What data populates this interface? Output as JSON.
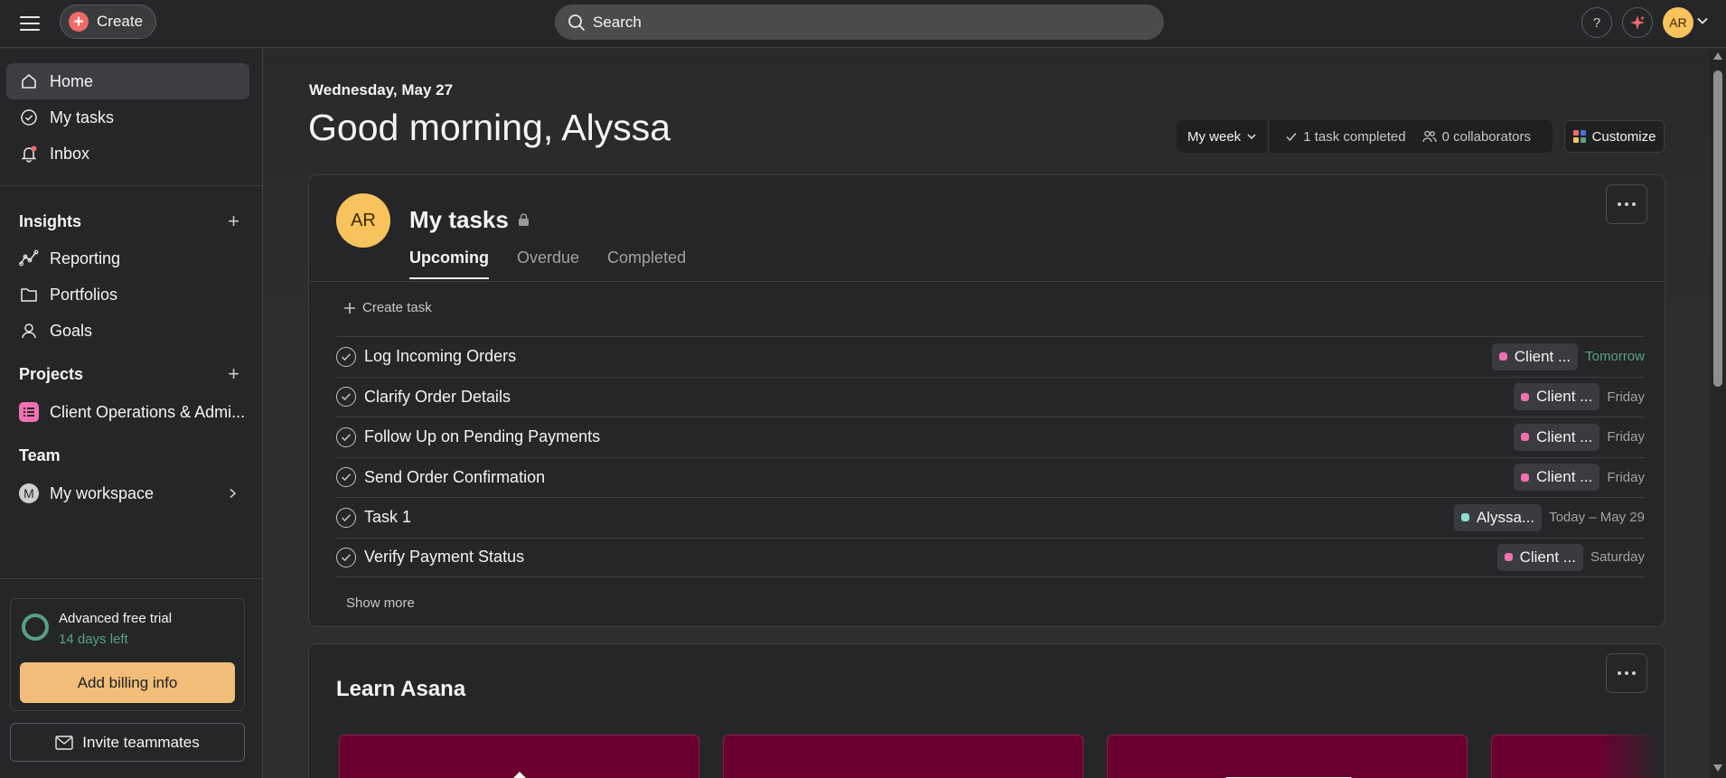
{
  "topbar": {
    "create_label": "Create",
    "search_placeholder": "Search",
    "help_label": "?",
    "avatar_initials": "AR"
  },
  "sidebar": {
    "nav": [
      {
        "label": "Home",
        "icon": "home-icon",
        "active": true
      },
      {
        "label": "My tasks",
        "icon": "check-circle-icon"
      },
      {
        "label": "Inbox",
        "icon": "bell-icon"
      }
    ],
    "insights": {
      "title": "Insights",
      "items": [
        {
          "label": "Reporting",
          "icon": "chart-line-icon"
        },
        {
          "label": "Portfolios",
          "icon": "folder-icon"
        },
        {
          "label": "Goals",
          "icon": "person-icon"
        }
      ]
    },
    "projects": {
      "title": "Projects",
      "items": [
        {
          "label": "Client Operations & Admi...",
          "icon": "project-list-icon",
          "color": "#f26fb2"
        }
      ]
    },
    "team": {
      "title": "Team",
      "items": [
        {
          "label": "My workspace",
          "avatar": "M"
        }
      ]
    },
    "trial": {
      "title": "Advanced free trial",
      "days_left": "14 days left",
      "billing_button": "Add billing info"
    },
    "invite_button": "Invite teammates"
  },
  "main": {
    "date": "Wednesday, May 27",
    "greeting": "Good morning, Alyssa",
    "stats": {
      "period": "My week",
      "tasks_completed": "1 task completed",
      "collaborators": "0 collaborators"
    },
    "customize_label": "Customize",
    "my_tasks": {
      "avatar_initials": "AR",
      "title": "My tasks",
      "tabs": [
        "Upcoming",
        "Overdue",
        "Completed"
      ],
      "active_tab": "Upcoming",
      "create_task_label": "Create task",
      "tasks": [
        {
          "name": "Log Incoming Orders",
          "project": "Client ...",
          "project_color": "#f26fb2",
          "due": "Tomorrow",
          "due_style": "tomorrow"
        },
        {
          "name": "Clarify Order Details",
          "project": "Client ...",
          "project_color": "#f26fb2",
          "due": "Friday"
        },
        {
          "name": "Follow Up on Pending Payments",
          "project": "Client ...",
          "project_color": "#f26fb2",
          "due": "Friday"
        },
        {
          "name": "Send Order Confirmation",
          "project": "Client ...",
          "project_color": "#f26fb2",
          "due": "Friday"
        },
        {
          "name": "Task 1",
          "project": "Alyssa...",
          "project_color": "#8de0cf",
          "due": "Today – May 29"
        },
        {
          "name": "Verify Payment Status",
          "project": "Client ...",
          "project_color": "#f26fb2",
          "due": "Saturday"
        }
      ],
      "show_more_label": "Show more"
    },
    "learn": {
      "title": "Learn Asana"
    }
  },
  "colors": {
    "accent_create": "#f06a6a",
    "billing_button": "#f1bd79",
    "trial_green": "#58a182",
    "avatar": "#f8c25c"
  }
}
